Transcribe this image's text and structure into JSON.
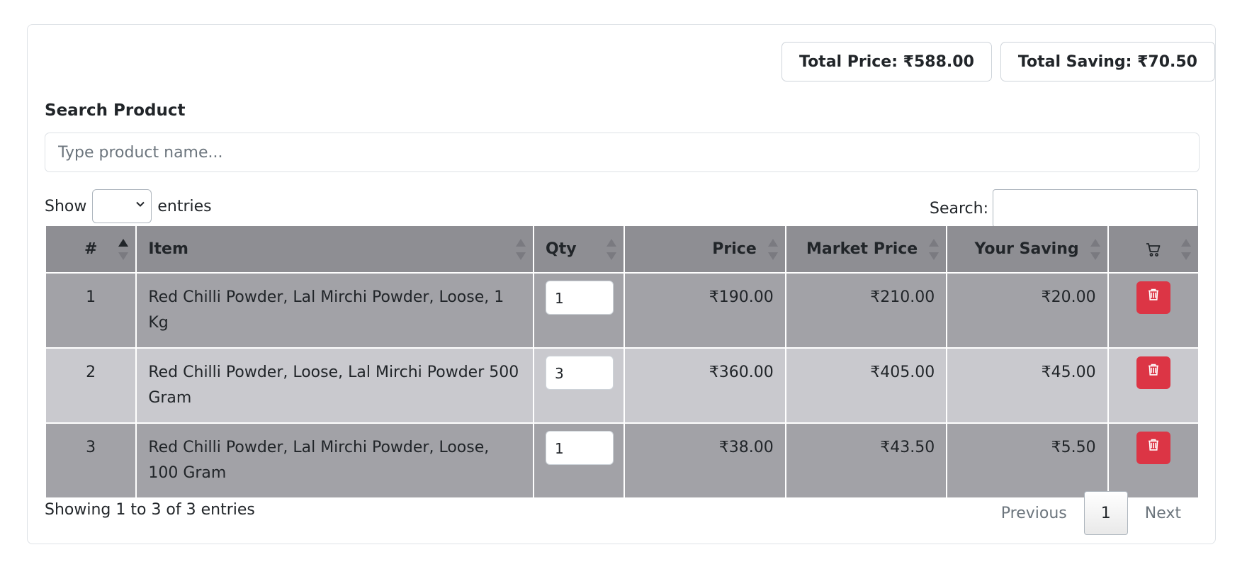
{
  "totals": {
    "total_price": "Total Price: ₹588.00",
    "total_saving": "Total Saving: ₹70.50"
  },
  "search_product": {
    "label": "Search Product",
    "placeholder": "Type product name..."
  },
  "length_menu": {
    "show_label": "Show",
    "entries_label": "entries",
    "selected_value": ""
  },
  "filter": {
    "label": "Search:",
    "value": ""
  },
  "table": {
    "columns": [
      {
        "label": "#",
        "sort": "asc"
      },
      {
        "label": "Item",
        "sort": "none"
      },
      {
        "label": "Qty",
        "sort": "none"
      },
      {
        "label": "Price",
        "sort": "none"
      },
      {
        "label": "Market Price",
        "sort": "none"
      },
      {
        "label": "Your Saving",
        "sort": "none"
      },
      {
        "label": "",
        "icon": "cart-icon",
        "sort": "none"
      }
    ],
    "rows": [
      {
        "num": "1",
        "item": "Red Chilli Powder, Lal Mirchi Powder, Loose, 1 Kg",
        "qty": "1",
        "price": "₹190.00",
        "market_price": "₹210.00",
        "saving": "₹20.00",
        "action_icon": "trash-icon"
      },
      {
        "num": "2",
        "item": "Red Chilli Powder, Loose, Lal Mirchi Powder 500 Gram",
        "qty": "3",
        "price": "₹360.00",
        "market_price": "₹405.00",
        "saving": "₹45.00",
        "action_icon": "trash-icon"
      },
      {
        "num": "3",
        "item": "Red Chilli Powder, Lal Mirchi Powder, Loose, 100 Gram",
        "qty": "1",
        "price": "₹38.00",
        "market_price": "₹43.50",
        "saving": "₹5.50",
        "action_icon": "trash-icon"
      }
    ]
  },
  "footer": {
    "info": "Showing 1 to 3 of 3 entries",
    "previous": "Previous",
    "current_page": "1",
    "next": "Next"
  },
  "colors": {
    "header_bg": "#8e8e93",
    "row_odd_bg": "#a2a2a7",
    "row_even_bg": "#c9c9ce",
    "danger": "#dc3545"
  }
}
